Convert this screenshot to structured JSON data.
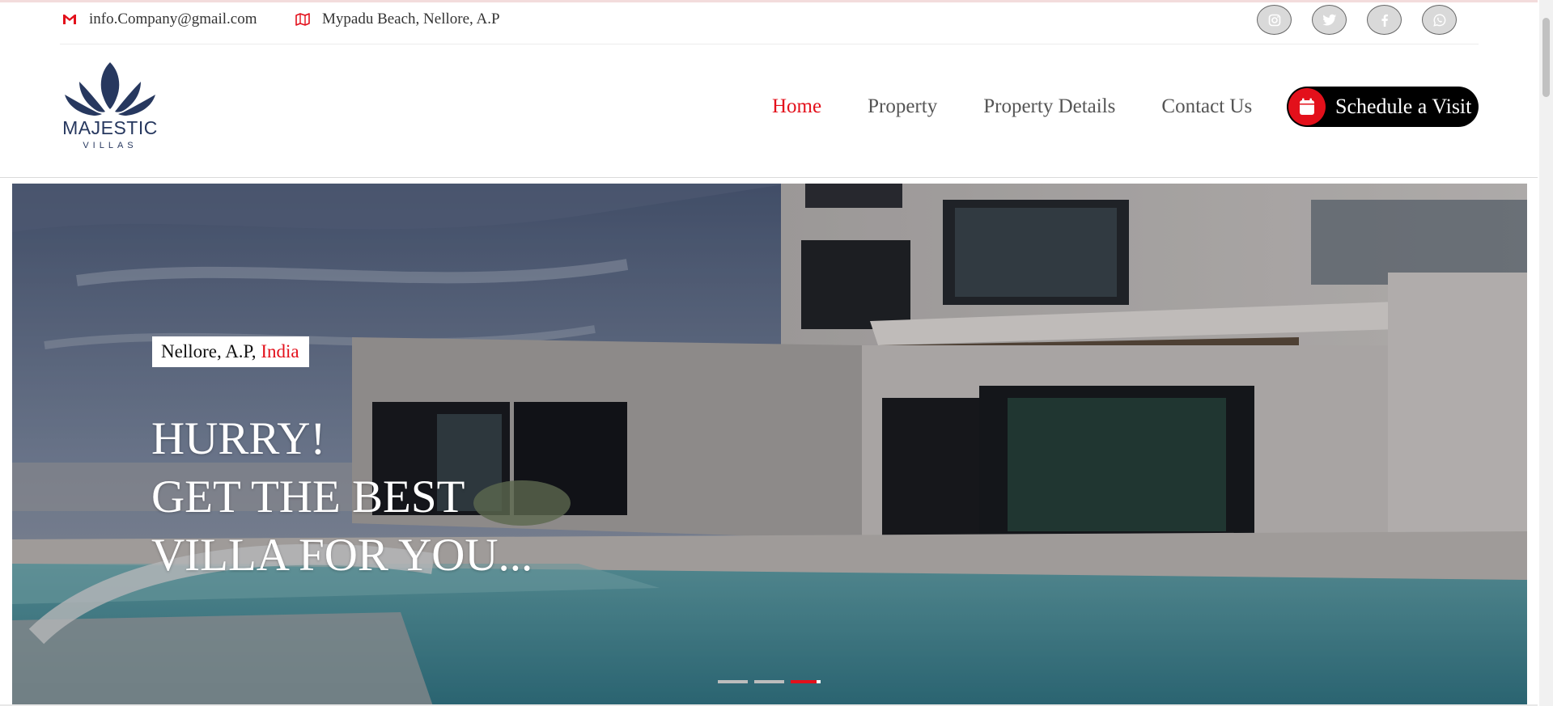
{
  "topbar": {
    "email": "info.Company@gmail.com",
    "address": "Mypadu Beach, Nellore, A.P",
    "socials": [
      {
        "icon": "instagram-icon"
      },
      {
        "icon": "twitter-icon"
      },
      {
        "icon": "facebook-icon"
      },
      {
        "icon": "whatsapp-icon"
      }
    ]
  },
  "brand": {
    "name": "MAJESTIC",
    "sub": "VILLAS",
    "color": "#27385f"
  },
  "nav": {
    "items": [
      "Home",
      "Property",
      "Property Details",
      "Contact Us"
    ],
    "active_index": 0,
    "accent": "#e3101b"
  },
  "cta": {
    "label": "Schedule a Visit",
    "icon": "calendar-icon"
  },
  "hero": {
    "location_prefix": "Nellore, A.P,",
    "location_accent": "India",
    "headline": [
      "HURRY!",
      "GET THE BEST",
      "VILLA FOR YOU..."
    ],
    "slides": 3,
    "active_slide": 3
  }
}
